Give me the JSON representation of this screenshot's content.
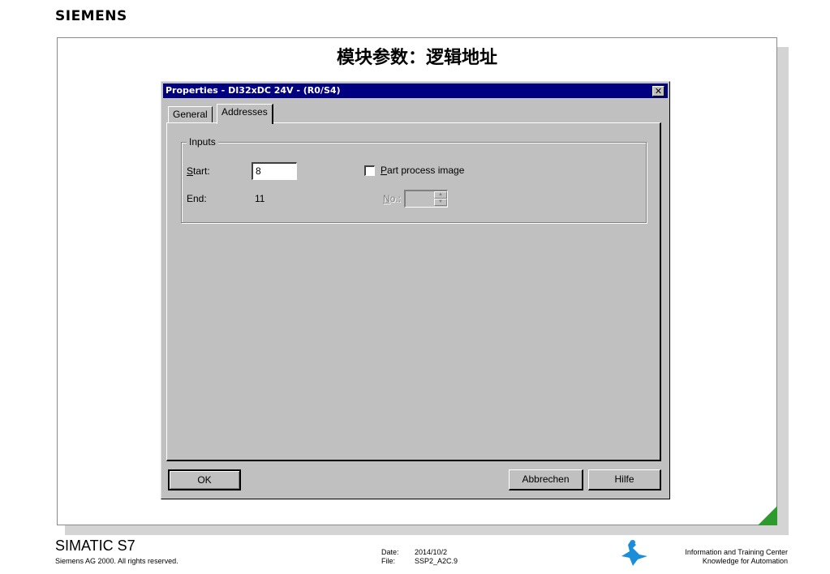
{
  "brand": "SIEMENS",
  "slide_title": "模块参数：逻辑地址",
  "dialog": {
    "title": "Properties - DI32xDC 24V - (R0/S4)",
    "close_label": "✕",
    "tabs": [
      {
        "label": "General",
        "active": false
      },
      {
        "label": "Addresses",
        "active": true
      }
    ],
    "group": {
      "label": "Inputs",
      "start_label_accel": "S",
      "start_label_rest": "tart:",
      "start_value": "8",
      "end_label": "End:",
      "end_value": "11",
      "part_image_accel": "P",
      "part_image_rest": "art process image",
      "part_image_checked": false,
      "no_label_accel": "N",
      "no_label_rest": "o.:",
      "no_value": ""
    },
    "buttons": {
      "ok": "OK",
      "cancel": "Abbrechen",
      "help": "Hilfe"
    }
  },
  "footer": {
    "product": "SIMATIC S7",
    "copyright": "Siemens AG 2000. All rights reserved.",
    "date_label": "Date:",
    "date_value": "2014/10/2",
    "file_label": "File:",
    "file_value": "SSP2_A2C.9",
    "itc_line1": "Information and Training Center",
    "itc_line2": "Knowledge for Automation"
  },
  "colors": {
    "titlebar": "#000080",
    "dialog_face": "#c0c0c0",
    "corner_accent": "#2e9a2e",
    "logo_blue": "#1a8fd8"
  }
}
